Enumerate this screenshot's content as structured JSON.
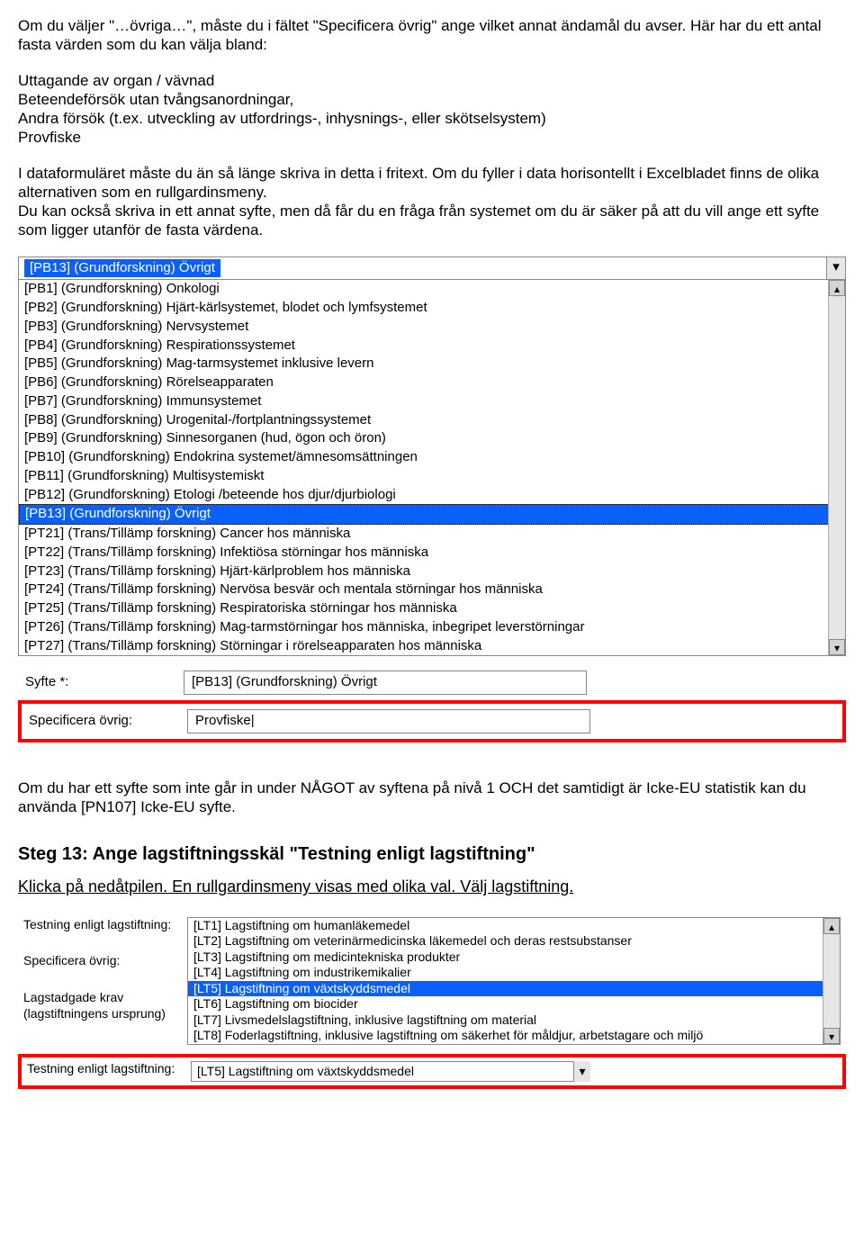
{
  "p1": "Om du väljer \"…övriga…\", måste du i fältet \"Specificera övrig\" ange vilket annat ändamål du avser. Här har du ett antal fasta värden som du kan välja bland:",
  "fixed_values": [
    "Uttagande av organ / vävnad",
    "Beteendeförsök utan tvångsanordningar,",
    "Andra försök (t.ex. utveckling av utfordrings-, inhysnings-, eller skötselsystem)",
    "Provfiske"
  ],
  "p2": "I dataformuläret måste du än så länge skriva in detta i fritext. Om du fyller i data horisontellt i Excelbladet finns de olika alternativen som en rullgardinsmeny.\nDu kan också skriva in ett annat syfte, men då får du en fråga från systemet om du är säker på att du vill ange ett syfte som ligger utanför de fasta värdena.",
  "dropdown": {
    "selected": "[PB13] (Grundforskning) Övrigt",
    "items": [
      "[PB1] (Grundforskning) Onkologi",
      "[PB2] (Grundforskning) Hjärt-kärlsystemet, blodet och lymfsystemet",
      "[PB3] (Grundforskning) Nervsystemet",
      "[PB4] (Grundforskning) Respirationssystemet",
      "[PB5] (Grundforskning) Mag-tarmsystemet inklusive levern",
      "[PB6] (Grundforskning) Rörelseapparaten",
      "[PB7] (Grundforskning) Immunsystemet",
      "[PB8] (Grundforskning) Urogenital-/fortplantningssystemet",
      "[PB9] (Grundforskning) Sinnesorganen (hud, ögon och öron)",
      "[PB10] (Grundforskning) Endokrina systemet/ämnesomsättningen",
      "[PB11] (Grundforskning) Multisystemiskt",
      "[PB12] (Grundforskning) Etologi /beteende hos djur/djurbiologi",
      "[PB13] (Grundforskning) Övrigt",
      "[PT21] (Trans/Tillämp forskning) Cancer hos människa",
      "[PT22] (Trans/Tillämp forskning) Infektiösa störningar hos människa",
      "[PT23] (Trans/Tillämp forskning) Hjärt-kärlproblem hos människa",
      "[PT24] (Trans/Tillämp forskning) Nervösa besvär och mentala störningar hos människa",
      "[PT25] (Trans/Tillämp forskning) Respiratoriska störningar hos människa",
      "[PT26] (Trans/Tillämp forskning) Mag-tarmstörningar hos människa, inbegripet leverstörningar",
      "[PT27] (Trans/Tillämp forskning) Störningar i rörelseapparaten hos människa"
    ],
    "highlight_index": 12
  },
  "form": {
    "syfte_label": "Syfte *:",
    "syfte_value": "[PB13] (Grundforskning) Övrigt",
    "spec_label": "Specificera övrig:",
    "spec_value": "Provfiske"
  },
  "p3": "Om du har ett syfte som inte går in under NÅGOT av syftena på nivå 1 OCH det samtidigt är Icke-EU statistik kan du använda [PN107] Icke-EU syfte.",
  "step13_title": "Steg 13: Ange lagstiftningsskäl \"Testning enligt lagstiftning\"",
  "step13_text": "Klicka på nedåtpilen. En rullgardinsmeny visas med olika val. Välj lagstiftning.",
  "lt": {
    "testning_label": "Testning enligt lagstiftning:",
    "spec_label": "Specificera övrig:",
    "lag_label": "Lagstadgade krav (lagstiftningens ursprung)",
    "items": [
      "[LT1] Lagstiftning om humanläkemedel",
      "[LT2] Lagstiftning om veterinärmedicinska läkemedel och deras restsubstanser",
      "[LT3] Lagstiftning om medicintekniska produkter",
      "[LT4] Lagstiftning om industrikemikalier",
      "[LT5] Lagstiftning om växtskyddsmedel",
      "[LT6] Lagstiftning om biocider",
      "[LT7] Livsmedelslagstiftning, inklusive lagstiftning om material",
      "[LT8] Foderlagstiftning, inklusive lagstiftning om säkerhet för måldjur, arbetstagare och miljö"
    ],
    "highlight_index": 4,
    "result_value": "[LT5] Lagstiftning om växtskyddsmedel"
  }
}
